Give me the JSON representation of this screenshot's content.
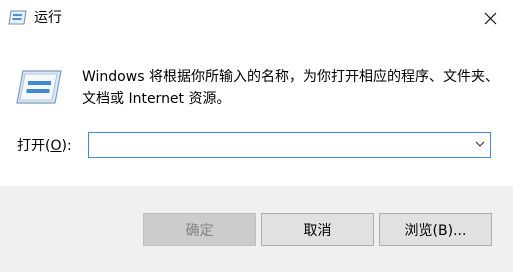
{
  "window": {
    "title": "运行",
    "close_icon": "close-icon",
    "app_icon": "run-icon"
  },
  "body": {
    "icon": "run-program-icon",
    "description": "Windows 将根据你所输入的名称，为你打开相应的程序、文件夹、文档或 Internet 资源。"
  },
  "open_field": {
    "label_prefix": "打开(",
    "label_hotkey": "O",
    "label_suffix": "):",
    "value": "",
    "dropdown_icon": "chevron-down-icon"
  },
  "buttons": {
    "ok": "确定",
    "cancel": "取消",
    "browse": "浏览(B)..."
  },
  "colors": {
    "focus_border": "#3d8ee8",
    "footer_bg": "#f0f0f0"
  }
}
